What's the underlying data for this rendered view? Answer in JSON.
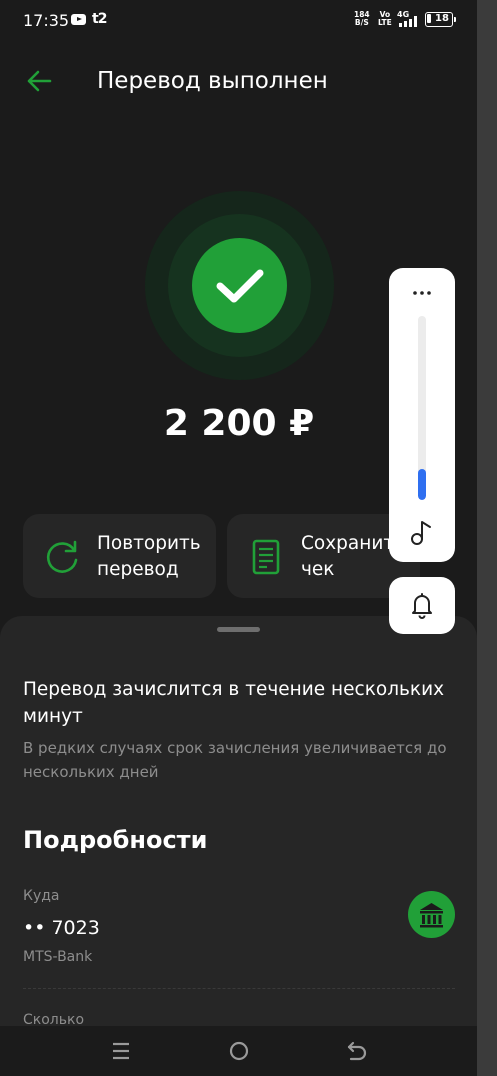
{
  "status_bar": {
    "time": "17:35",
    "carrier": "t2",
    "net_speed_value": "184",
    "net_speed_unit": "B/S",
    "volte_top": "Vo",
    "volte_bottom": "LTE",
    "network": "4G",
    "battery_level": "18"
  },
  "header": {
    "title": "Перевод выполнен"
  },
  "result": {
    "amount": "2 200 ₽"
  },
  "actions": {
    "repeat_label": "Повторить\nперевод",
    "save_label": "Сохранить\nчек"
  },
  "sheet": {
    "info_title": "Перевод зачислится в течение нескольких минут",
    "info_subtitle": "В редких случаях срок зачисления увеличивается до нескольких дней",
    "details_title": "Подробности",
    "to_label": "Куда",
    "account_number": "•• 7023",
    "bank_name": "MTS-Bank",
    "amount_label": "Сколько"
  },
  "volume_overlay": {
    "level": 0.17
  },
  "colors": {
    "accent": "#21a038",
    "background": "#1b1b1b",
    "card": "#262626",
    "secondary_text": "#8d8d8d",
    "volume_fill": "#2f6ff0"
  },
  "icons": {
    "back": "arrow-left-icon",
    "success": "check-icon",
    "repeat": "refresh-icon",
    "save": "receipt-icon",
    "bank": "bank-icon",
    "more": "more-dots-icon",
    "music": "music-note-icon",
    "bell": "bell-icon"
  }
}
